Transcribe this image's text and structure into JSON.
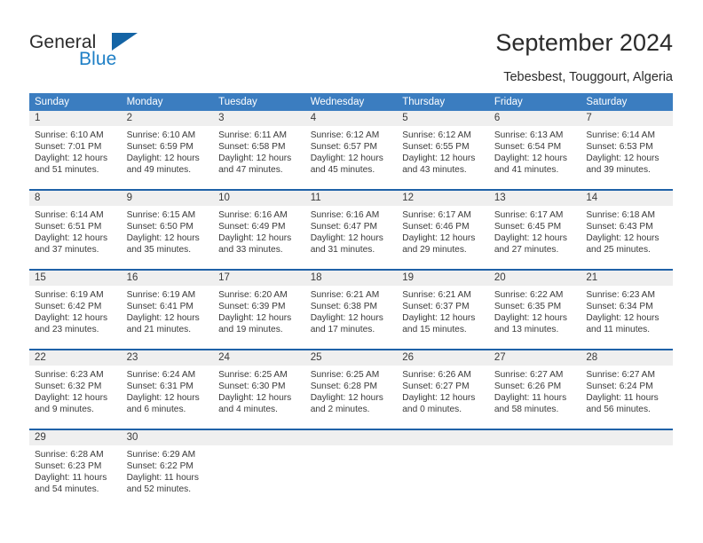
{
  "brand": {
    "name_part1": "General",
    "name_part2": "Blue",
    "flag_icon": "triangle-flag-icon",
    "accent_blue": "#1e7fc6",
    "flag_blue": "#1464a5"
  },
  "header": {
    "title": "September 2024",
    "subtitle": "Tebesbest, Touggourt, Algeria"
  },
  "theme": {
    "header_bg": "#3b7dc0",
    "row_border": "#1f62a8",
    "daynum_bg": "#efefef",
    "text": "#3a3a3a"
  },
  "weekdays": [
    "Sunday",
    "Monday",
    "Tuesday",
    "Wednesday",
    "Thursday",
    "Friday",
    "Saturday"
  ],
  "weeks": [
    [
      {
        "day": "1",
        "sunrise": "Sunrise: 6:10 AM",
        "sunset": "Sunset: 7:01 PM",
        "daylight1": "Daylight: 12 hours",
        "daylight2": "and 51 minutes."
      },
      {
        "day": "2",
        "sunrise": "Sunrise: 6:10 AM",
        "sunset": "Sunset: 6:59 PM",
        "daylight1": "Daylight: 12 hours",
        "daylight2": "and 49 minutes."
      },
      {
        "day": "3",
        "sunrise": "Sunrise: 6:11 AM",
        "sunset": "Sunset: 6:58 PM",
        "daylight1": "Daylight: 12 hours",
        "daylight2": "and 47 minutes."
      },
      {
        "day": "4",
        "sunrise": "Sunrise: 6:12 AM",
        "sunset": "Sunset: 6:57 PM",
        "daylight1": "Daylight: 12 hours",
        "daylight2": "and 45 minutes."
      },
      {
        "day": "5",
        "sunrise": "Sunrise: 6:12 AM",
        "sunset": "Sunset: 6:55 PM",
        "daylight1": "Daylight: 12 hours",
        "daylight2": "and 43 minutes."
      },
      {
        "day": "6",
        "sunrise": "Sunrise: 6:13 AM",
        "sunset": "Sunset: 6:54 PM",
        "daylight1": "Daylight: 12 hours",
        "daylight2": "and 41 minutes."
      },
      {
        "day": "7",
        "sunrise": "Sunrise: 6:14 AM",
        "sunset": "Sunset: 6:53 PM",
        "daylight1": "Daylight: 12 hours",
        "daylight2": "and 39 minutes."
      }
    ],
    [
      {
        "day": "8",
        "sunrise": "Sunrise: 6:14 AM",
        "sunset": "Sunset: 6:51 PM",
        "daylight1": "Daylight: 12 hours",
        "daylight2": "and 37 minutes."
      },
      {
        "day": "9",
        "sunrise": "Sunrise: 6:15 AM",
        "sunset": "Sunset: 6:50 PM",
        "daylight1": "Daylight: 12 hours",
        "daylight2": "and 35 minutes."
      },
      {
        "day": "10",
        "sunrise": "Sunrise: 6:16 AM",
        "sunset": "Sunset: 6:49 PM",
        "daylight1": "Daylight: 12 hours",
        "daylight2": "and 33 minutes."
      },
      {
        "day": "11",
        "sunrise": "Sunrise: 6:16 AM",
        "sunset": "Sunset: 6:47 PM",
        "daylight1": "Daylight: 12 hours",
        "daylight2": "and 31 minutes."
      },
      {
        "day": "12",
        "sunrise": "Sunrise: 6:17 AM",
        "sunset": "Sunset: 6:46 PM",
        "daylight1": "Daylight: 12 hours",
        "daylight2": "and 29 minutes."
      },
      {
        "day": "13",
        "sunrise": "Sunrise: 6:17 AM",
        "sunset": "Sunset: 6:45 PM",
        "daylight1": "Daylight: 12 hours",
        "daylight2": "and 27 minutes."
      },
      {
        "day": "14",
        "sunrise": "Sunrise: 6:18 AM",
        "sunset": "Sunset: 6:43 PM",
        "daylight1": "Daylight: 12 hours",
        "daylight2": "and 25 minutes."
      }
    ],
    [
      {
        "day": "15",
        "sunrise": "Sunrise: 6:19 AM",
        "sunset": "Sunset: 6:42 PM",
        "daylight1": "Daylight: 12 hours",
        "daylight2": "and 23 minutes."
      },
      {
        "day": "16",
        "sunrise": "Sunrise: 6:19 AM",
        "sunset": "Sunset: 6:41 PM",
        "daylight1": "Daylight: 12 hours",
        "daylight2": "and 21 minutes."
      },
      {
        "day": "17",
        "sunrise": "Sunrise: 6:20 AM",
        "sunset": "Sunset: 6:39 PM",
        "daylight1": "Daylight: 12 hours",
        "daylight2": "and 19 minutes."
      },
      {
        "day": "18",
        "sunrise": "Sunrise: 6:21 AM",
        "sunset": "Sunset: 6:38 PM",
        "daylight1": "Daylight: 12 hours",
        "daylight2": "and 17 minutes."
      },
      {
        "day": "19",
        "sunrise": "Sunrise: 6:21 AM",
        "sunset": "Sunset: 6:37 PM",
        "daylight1": "Daylight: 12 hours",
        "daylight2": "and 15 minutes."
      },
      {
        "day": "20",
        "sunrise": "Sunrise: 6:22 AM",
        "sunset": "Sunset: 6:35 PM",
        "daylight1": "Daylight: 12 hours",
        "daylight2": "and 13 minutes."
      },
      {
        "day": "21",
        "sunrise": "Sunrise: 6:23 AM",
        "sunset": "Sunset: 6:34 PM",
        "daylight1": "Daylight: 12 hours",
        "daylight2": "and 11 minutes."
      }
    ],
    [
      {
        "day": "22",
        "sunrise": "Sunrise: 6:23 AM",
        "sunset": "Sunset: 6:32 PM",
        "daylight1": "Daylight: 12 hours",
        "daylight2": "and 9 minutes."
      },
      {
        "day": "23",
        "sunrise": "Sunrise: 6:24 AM",
        "sunset": "Sunset: 6:31 PM",
        "daylight1": "Daylight: 12 hours",
        "daylight2": "and 6 minutes."
      },
      {
        "day": "24",
        "sunrise": "Sunrise: 6:25 AM",
        "sunset": "Sunset: 6:30 PM",
        "daylight1": "Daylight: 12 hours",
        "daylight2": "and 4 minutes."
      },
      {
        "day": "25",
        "sunrise": "Sunrise: 6:25 AM",
        "sunset": "Sunset: 6:28 PM",
        "daylight1": "Daylight: 12 hours",
        "daylight2": "and 2 minutes."
      },
      {
        "day": "26",
        "sunrise": "Sunrise: 6:26 AM",
        "sunset": "Sunset: 6:27 PM",
        "daylight1": "Daylight: 12 hours",
        "daylight2": "and 0 minutes."
      },
      {
        "day": "27",
        "sunrise": "Sunrise: 6:27 AM",
        "sunset": "Sunset: 6:26 PM",
        "daylight1": "Daylight: 11 hours",
        "daylight2": "and 58 minutes."
      },
      {
        "day": "28",
        "sunrise": "Sunrise: 6:27 AM",
        "sunset": "Sunset: 6:24 PM",
        "daylight1": "Daylight: 11 hours",
        "daylight2": "and 56 minutes."
      }
    ],
    [
      {
        "day": "29",
        "sunrise": "Sunrise: 6:28 AM",
        "sunset": "Sunset: 6:23 PM",
        "daylight1": "Daylight: 11 hours",
        "daylight2": "and 54 minutes."
      },
      {
        "day": "30",
        "sunrise": "Sunrise: 6:29 AM",
        "sunset": "Sunset: 6:22 PM",
        "daylight1": "Daylight: 11 hours",
        "daylight2": "and 52 minutes."
      },
      {
        "day": "",
        "sunrise": "",
        "sunset": "",
        "daylight1": "",
        "daylight2": ""
      },
      {
        "day": "",
        "sunrise": "",
        "sunset": "",
        "daylight1": "",
        "daylight2": ""
      },
      {
        "day": "",
        "sunrise": "",
        "sunset": "",
        "daylight1": "",
        "daylight2": ""
      },
      {
        "day": "",
        "sunrise": "",
        "sunset": "",
        "daylight1": "",
        "daylight2": ""
      },
      {
        "day": "",
        "sunrise": "",
        "sunset": "",
        "daylight1": "",
        "daylight2": ""
      }
    ]
  ]
}
